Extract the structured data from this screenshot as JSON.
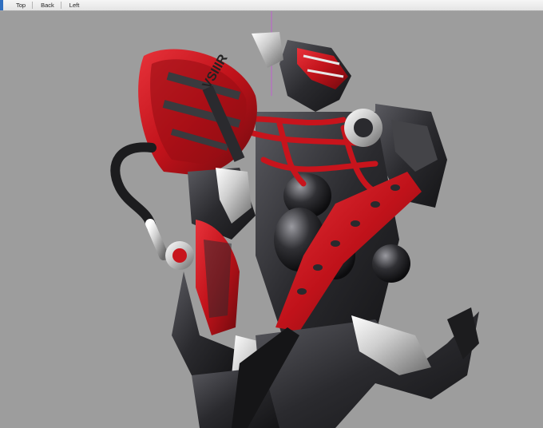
{
  "toolbar": {
    "views": [
      {
        "label": "Top"
      },
      {
        "label": "Back"
      },
      {
        "label": "Left"
      }
    ]
  },
  "viewport": {
    "background": "#9c9c9c",
    "cursor_guide_color": "#c060d0",
    "model": {
      "primary_color": "#c8141c",
      "secondary_color": "#2a2a2e",
      "chrome_color": "#d8d8d8"
    },
    "helmet_text": "VSIIIR"
  }
}
